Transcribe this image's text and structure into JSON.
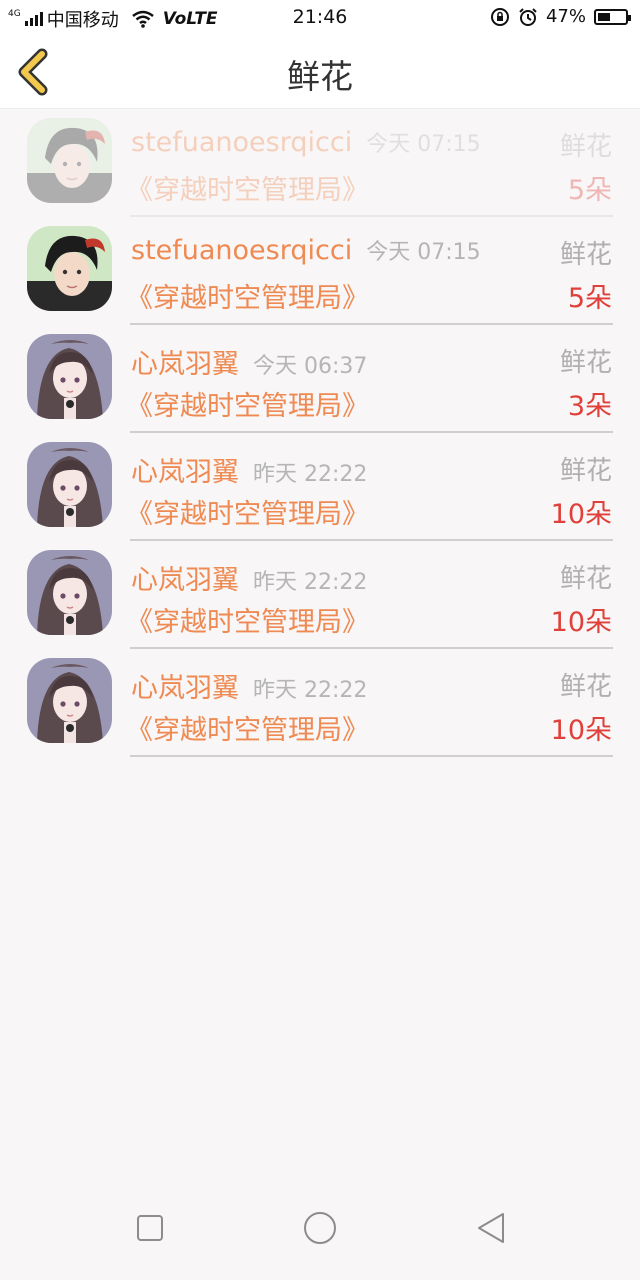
{
  "status_bar": {
    "network": "4G",
    "carrier": "中国移动",
    "volte": "VoLTE",
    "time": "21:46",
    "battery_percent_label": "47%",
    "battery_level": 0.47
  },
  "header": {
    "title": "鲜花",
    "back_icon": "chevron-left-icon",
    "accent": "#f2c94c"
  },
  "rows": [
    {
      "name": "stefuanoesrqicci",
      "time": "今天 07:15",
      "book": "《穿越时空管理局》",
      "gift": "鲜花",
      "count": "5朵",
      "avatar": "avatar-boy"
    },
    {
      "name": "stefuanoesrqicci",
      "time": "今天 07:15",
      "book": "《穿越时空管理局》",
      "gift": "鲜花",
      "count": "5朵",
      "avatar": "avatar-boy"
    },
    {
      "name": "心岚羽翼",
      "time": "今天 06:37",
      "book": "《穿越时空管理局》",
      "gift": "鲜花",
      "count": "3朵",
      "avatar": "avatar-girl"
    },
    {
      "name": "心岚羽翼",
      "time": "昨天 22:22",
      "book": "《穿越时空管理局》",
      "gift": "鲜花",
      "count": "10朵",
      "avatar": "avatar-girl"
    },
    {
      "name": "心岚羽翼",
      "time": "昨天 22:22",
      "book": "《穿越时空管理局》",
      "gift": "鲜花",
      "count": "10朵",
      "avatar": "avatar-girl"
    },
    {
      "name": "心岚羽翼",
      "time": "昨天 22:22",
      "book": "《穿越时空管理局》",
      "gift": "鲜花",
      "count": "10朵",
      "avatar": "avatar-girl"
    }
  ],
  "nav_bar": {
    "recent_icon": "square-icon",
    "home_icon": "circle-icon",
    "back_icon": "triangle-back-icon"
  },
  "colors": {
    "name_orange": "#ee8a52",
    "count_red": "#e0403a",
    "muted_gray": "#b5b5b5",
    "background": "#f8f6f7"
  }
}
